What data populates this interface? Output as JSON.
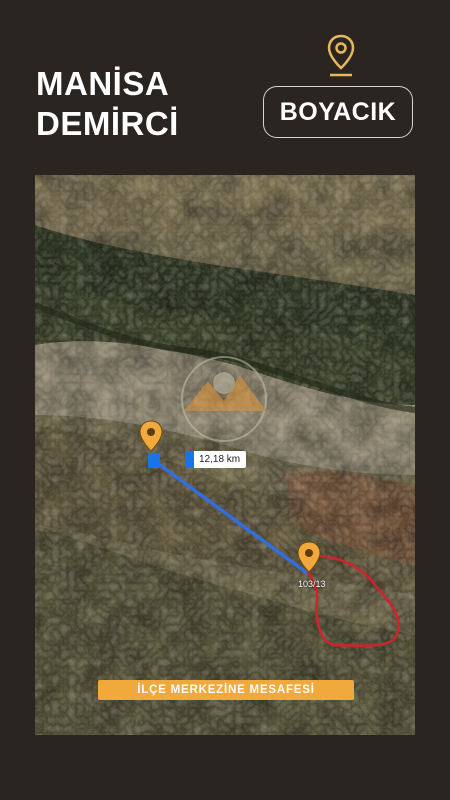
{
  "header": {
    "city": "MANİSA",
    "district": "DEMİRCİ",
    "location_badge": "BOYACIK",
    "location_icon": "map-pin-icon",
    "accent_color": "#e6b85c"
  },
  "map": {
    "distance_label": "12,18 km",
    "parcel_label": "103/13",
    "route_color": "#2f6fe0",
    "parcel_outline_color": "#d0232a",
    "marker_color": "#f1a93c",
    "banner": "İLÇE MERKEZİNE MESAFESİ",
    "banner_color": "#f2a93b"
  }
}
